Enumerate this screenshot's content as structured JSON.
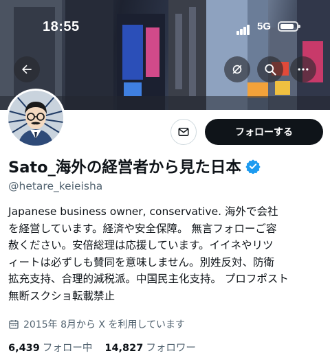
{
  "status_bar": {
    "time": "18:55",
    "network": "5G"
  },
  "profile_actions": {
    "follow_label": "フォローする"
  },
  "profile": {
    "display_name": "Sato_海外の経営者から見た日本",
    "handle": "@hetare_keieisha",
    "bio_lines": [
      "Japanese business owner, conservative. 海外で会社",
      "を経営しています。経済や安全保障。 無言フォローご容",
      "赦ください。安倍総理は応援しています。イイネやリツ",
      "ィートは必ずしも賛同を意味しません。別姓反対、防衛",
      "拡充支持、合理的減税派。中国民主化支持。 プロフポスト",
      "無断スクショ転載禁止"
    ],
    "joined": "2015年 8月から X を利用しています"
  },
  "stats": {
    "following_count": "6,439",
    "following_label": "フォロー中",
    "followers_count": "14,827",
    "followers_label": "フォロワー"
  },
  "colors": {
    "follow_button": "#0f1419",
    "verified_badge": "#1d9bf0",
    "secondary_text": "#536471"
  },
  "icons": [
    "back-arrow-icon",
    "hide-icon",
    "search-icon",
    "more-icon",
    "mail-icon",
    "verified-badge-icon",
    "calendar-icon"
  ]
}
